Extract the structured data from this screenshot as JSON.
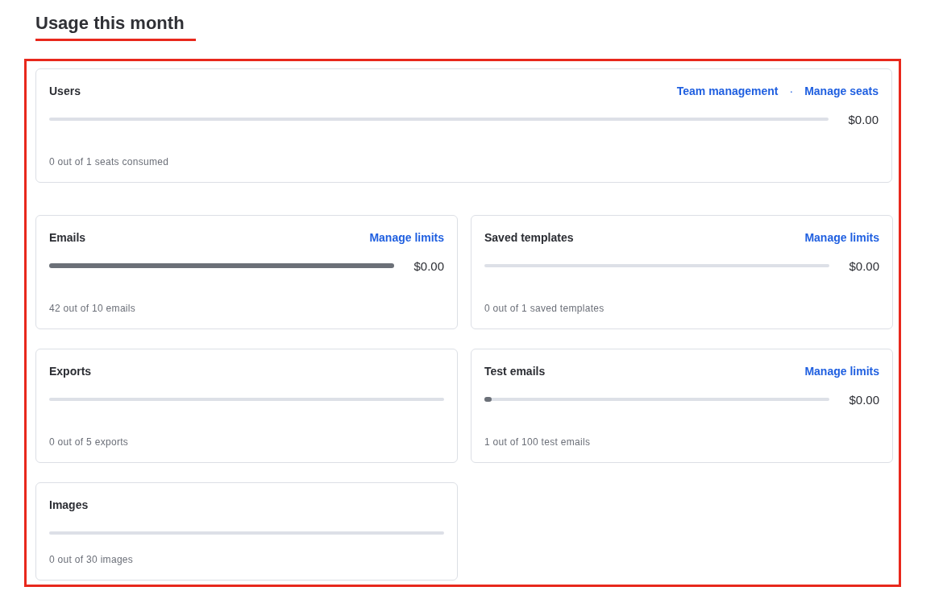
{
  "heading": "Usage this month",
  "users": {
    "title": "Users",
    "links": [
      "Team management",
      "Manage seats"
    ],
    "separator": "·",
    "price": "$0.00",
    "caption": "0 out of 1 seats consumed"
  },
  "cards": [
    {
      "title": "Emails",
      "links": [
        "Manage limits"
      ],
      "level": 1,
      "price": "$0.00",
      "caption": "42 out of 10 emails"
    },
    {
      "title": "Saved templates",
      "links": [
        "Manage limits"
      ],
      "price": "$0.00",
      "caption": "0 out of 1 saved templates"
    },
    {
      "title": "Exports",
      "caption": "0 out of 5 exports"
    },
    {
      "title": "Test emails",
      "links": [
        "Manage limits"
      ],
      "level": 0.02,
      "price": "$0.00",
      "caption": "1 out of 100 test emails"
    },
    {
      "title": "Images",
      "caption": "0 out of 30 images"
    }
  ]
}
